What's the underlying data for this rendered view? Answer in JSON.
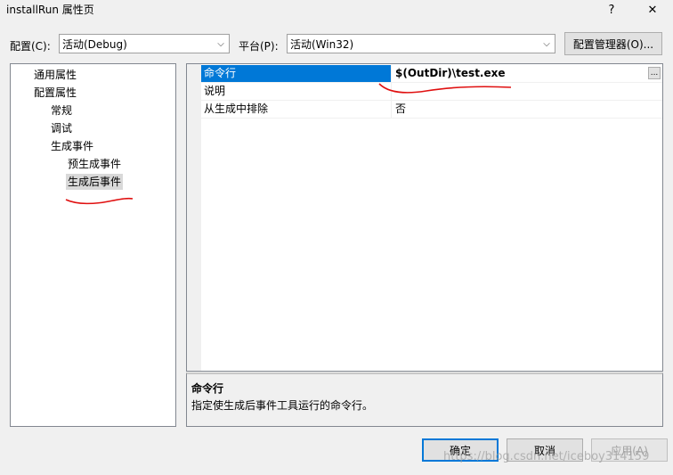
{
  "window": {
    "title": "installRun 属性页",
    "help_label": "?",
    "close_label": "✕"
  },
  "toolbar": {
    "config_label": "配置(C):",
    "config_value": "活动(Debug)",
    "platform_label": "平台(P):",
    "platform_value": "活动(Win32)",
    "config_manager_label": "配置管理器(O)..."
  },
  "tree": {
    "items": [
      {
        "label": "通用属性"
      },
      {
        "label": "配置属性"
      },
      {
        "label": "常规"
      },
      {
        "label": "调试"
      },
      {
        "label": "生成事件"
      },
      {
        "label": "预生成事件"
      },
      {
        "label": "生成后事件"
      }
    ]
  },
  "grid": {
    "rows": [
      {
        "name": "命令行",
        "value": "$(OutDir)\\test.exe"
      },
      {
        "name": "说明",
        "value": ""
      },
      {
        "name": "从生成中排除",
        "value": "否"
      }
    ],
    "ellipsis_label": "..."
  },
  "description": {
    "title": "命令行",
    "text": "指定使生成后事件工具运行的命令行。"
  },
  "buttons": {
    "ok": "确定",
    "cancel": "取消",
    "apply": "应用(A)"
  },
  "watermark": "https://blog.csdn.net/iceboy314159",
  "colors": {
    "selection": "#0078d7",
    "annotation": "#e01010"
  }
}
